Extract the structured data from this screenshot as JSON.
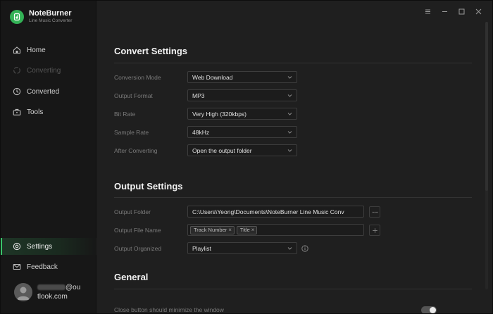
{
  "brand": {
    "name": "NoteBurner",
    "subtitle": "Line Music Converter"
  },
  "sidebar": {
    "items": [
      {
        "label": "Home",
        "icon": "home-icon"
      },
      {
        "label": "Converting",
        "icon": "converting-icon",
        "disabled": true
      },
      {
        "label": "Converted",
        "icon": "clock-icon"
      },
      {
        "label": "Tools",
        "icon": "toolbox-icon"
      }
    ],
    "settings": {
      "label": "Settings",
      "icon": "gear-icon",
      "active": true
    },
    "feedback": {
      "label": "Feedback",
      "icon": "mail-icon"
    },
    "user": {
      "email_suffix": "@ou",
      "email_line2": "tlook.com"
    }
  },
  "window_controls": [
    "menu-icon",
    "minimize-icon",
    "maximize-icon",
    "close-icon"
  ],
  "convert_settings": {
    "title": "Convert Settings",
    "rows": [
      {
        "label": "Conversion Mode",
        "value": "Web Download"
      },
      {
        "label": "Output Format",
        "value": "MP3"
      },
      {
        "label": "Bit Rate",
        "value": "Very High (320kbps)"
      },
      {
        "label": "Sample Rate",
        "value": "48kHz"
      },
      {
        "label": "After Converting",
        "value": "Open the output folder"
      }
    ]
  },
  "output_settings": {
    "title": "Output Settings",
    "folder": {
      "label": "Output Folder",
      "value": "C:\\Users\\Yeong\\Documents\\NoteBurner Line Music Conv",
      "button": "···"
    },
    "file_name": {
      "label": "Output File Name",
      "tags": [
        "Track Number",
        "Title"
      ],
      "button": "+"
    },
    "organized": {
      "label": "Output Organized",
      "value": "Playlist"
    }
  },
  "general": {
    "title": "General",
    "minimize_label": "Close button should minimize the window",
    "minimize_enabled": true
  },
  "colors": {
    "accent": "#39c56a",
    "background": "#1f1f1f",
    "sidebar": "#171717"
  }
}
